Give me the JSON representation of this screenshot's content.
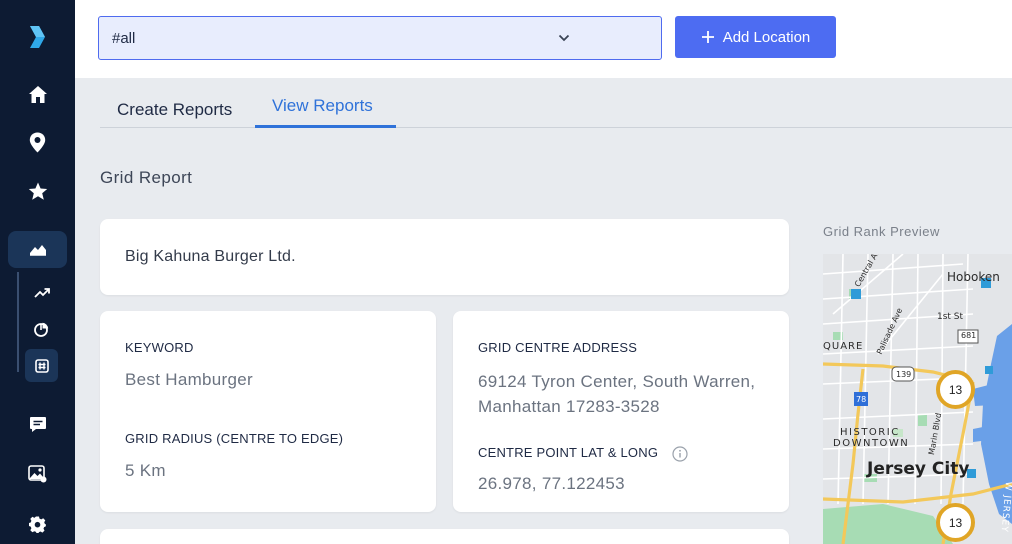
{
  "topbar": {
    "location_value": "#all",
    "add_location_label": "Add Location"
  },
  "tabs": [
    {
      "label": "Create Reports",
      "active": false
    },
    {
      "label": "View Reports",
      "active": true
    }
  ],
  "section_title": "Grid Report",
  "business": {
    "name": "Big Kahuna Burger Ltd."
  },
  "keyword_card": {
    "keyword_label": "KEYWORD",
    "keyword_value": "Best Hamburger",
    "radius_label": "GRID RADIUS (CENTRE TO EDGE)",
    "radius_value": "5 Km"
  },
  "address_card": {
    "address_label": "GRID CENTRE ADDRESS",
    "address_line1": "69124 Tyron Center, South Warren,",
    "address_line2": "Manhattan 17283-3528",
    "latlong_label": "CENTRE POINT LAT & LONG",
    "latlong_value": "26.978,  77.122453"
  },
  "preview": {
    "label": "Grid Rank Preview",
    "map_labels": {
      "hoboken": "Hoboken",
      "central_ave": "Central Ave",
      "palisade_ave": "Palisade Ave",
      "first_st": "1st St",
      "quare": "QUARE",
      "route_681": "681",
      "route_139": "139",
      "route_78": "78",
      "historic": "HISTORIC",
      "downtown": "DOWNTOWN",
      "marin_blvd": "Marin Blvd",
      "jersey_city": "Jersey City",
      "new_jersey": "W JERSEY"
    },
    "rank_pins": [
      {
        "rank": "13"
      },
      {
        "rank": "13"
      }
    ]
  },
  "colors": {
    "sidebar": "#0d1b33",
    "accent": "#4d6cf2",
    "tab_active": "#2f72d9",
    "pin_ring": "#e0a526"
  },
  "sidebar_icons": [
    "logo-chevron-icon",
    "home-icon",
    "location-pin-icon",
    "star-icon",
    "chart-mountain-icon",
    "trend-up-icon",
    "pie-chart-icon",
    "grid-hash-icon",
    "chat-icon",
    "image-icon",
    "gear-icon"
  ]
}
